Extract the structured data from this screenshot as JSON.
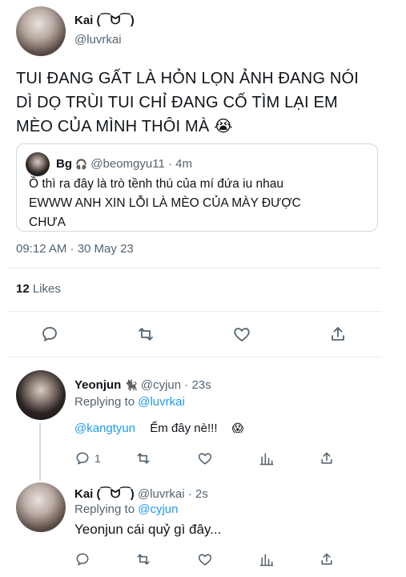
{
  "main_tweet": {
    "display_name": "Kai (⁀ᗢ⁀)",
    "handle": "@luvrkai",
    "text_lines": [
      "TUI ĐANG GẤT LÀ HỎN LỌN ẢNH ĐANG NÓI",
      "DÌ DỌ TRÙI TUI CHỈ ĐANG CỐ TÌM LẠI EM",
      "MÈO CỦA MÌNH THÔI MÀ 😭"
    ],
    "quoted": {
      "display_name": "Bg",
      "name_emoji": "🎧",
      "handle": "@beomgyu11",
      "separator": "·",
      "time": "4m",
      "text_lines": [
        "Ồ thì ra đây là trò tềnh thú của mí đứa iu nhau",
        "EWWW ANH XIN LỖI LÀ MÈO CỦA MÀY ĐƯỢC",
        "CHƯA"
      ]
    },
    "timestamp": "09:12 AM · 30 May 23",
    "likes_count": "12",
    "likes_label": "Likes"
  },
  "replies": [
    {
      "display_name": "Yeonjun",
      "name_emoji": "🐈‍⬛",
      "handle": "@cyjun",
      "separator": "·",
      "time": "23s",
      "replying_prefix": "Replying to",
      "replying_to": "@luvrkai",
      "mention": "@kangtyun",
      "text": "Ểm đây nè!!!",
      "emoji": "😱",
      "reply_count": "1"
    },
    {
      "display_name": "Kai (⁀ᗢ⁀)",
      "handle": "@luvrkai",
      "separator": "·",
      "time": "2s",
      "replying_prefix": "Replying to",
      "replying_to": "@cyjun",
      "text": "Yeonjun cái quỷ gì đây..."
    }
  ],
  "colors": {
    "accent": "#1d9bf0",
    "muted": "#536471",
    "text": "#0f1419",
    "border": "#cfd9de"
  }
}
